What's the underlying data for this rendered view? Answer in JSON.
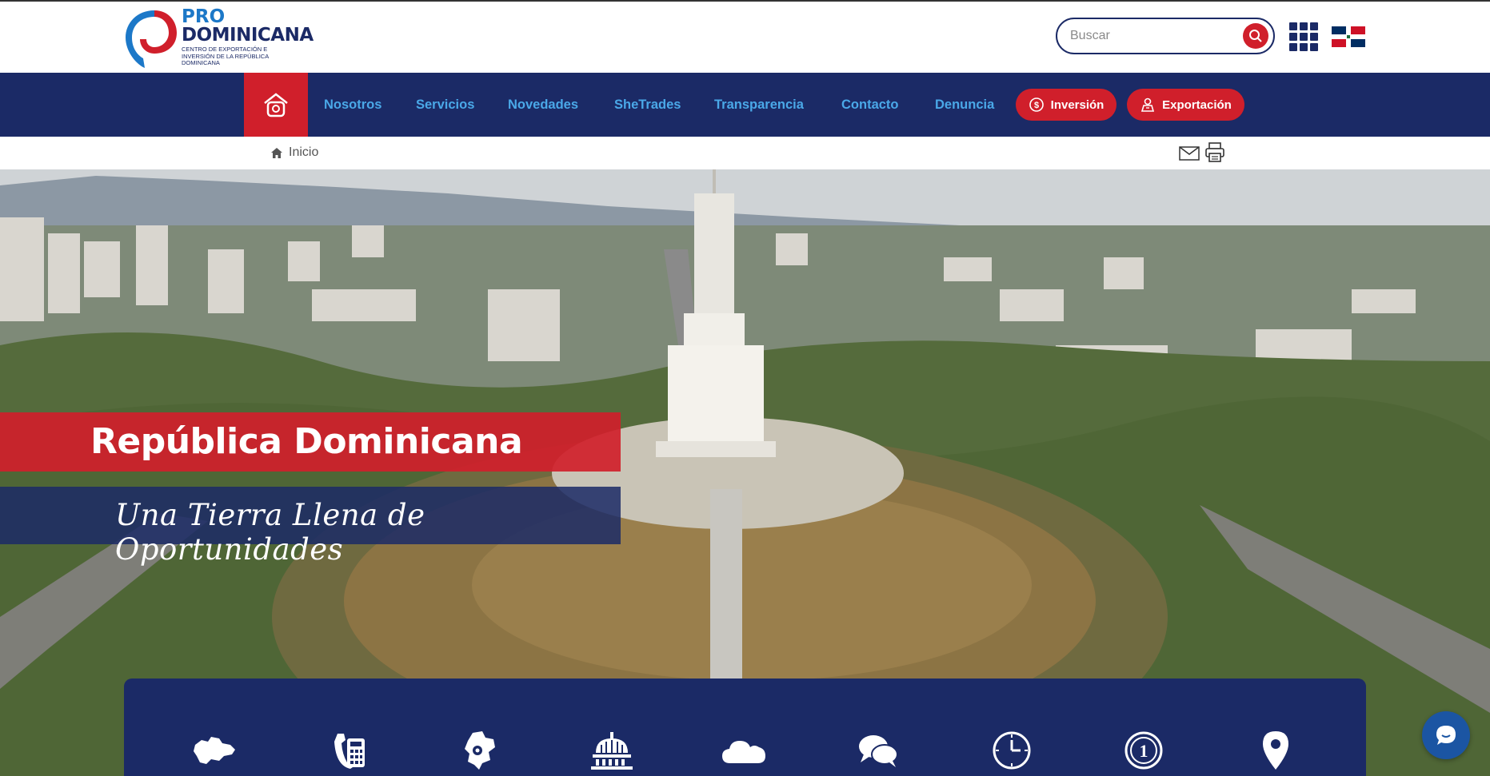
{
  "brand": {
    "line1": "PRO",
    "line2": "DOMINICANA",
    "tagline": "CENTRO DE EXPORTACIÓN E INVERSIÓN DE LA REPÚBLICA DOMINICANA"
  },
  "search": {
    "placeholder": "Buscar"
  },
  "nav": {
    "links": [
      "Nosotros",
      "Servicios",
      "Novedades",
      "SheTrades",
      "Transparencia",
      "Contacto",
      "Denuncia"
    ],
    "pills": [
      "Inversión",
      "Exportación"
    ]
  },
  "breadcrumb": {
    "home": "Inicio"
  },
  "hero": {
    "title": "República Dominicana",
    "subtitle": "Una Tierra Llena de Oportunidades"
  },
  "quick_links": {
    "icons": [
      "map-icon",
      "phone-icon",
      "location-map-icon",
      "government-icon",
      "cloud-icon",
      "chat-icon",
      "clock-icon",
      "coin-icon",
      "pin-icon"
    ]
  },
  "colors": {
    "navy": "#1b2a66",
    "red": "#d01f2b",
    "link_blue": "#4aa8e8"
  }
}
